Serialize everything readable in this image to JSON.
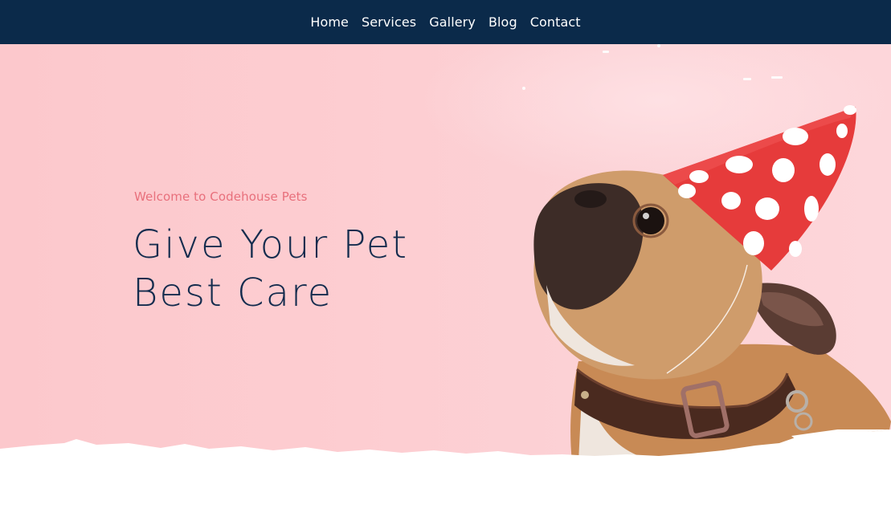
{
  "nav": {
    "items": [
      {
        "label": "Home"
      },
      {
        "label": "Services"
      },
      {
        "label": "Gallery"
      },
      {
        "label": "Blog"
      },
      {
        "label": "Contact"
      }
    ]
  },
  "hero": {
    "eyebrow": "Welcome to Codehouse Pets",
    "headline_line1": "Give Your Pet",
    "headline_line2": "Best Care",
    "image": "pug-in-party-hat"
  },
  "colors": {
    "nav_background": "#0b2a4a",
    "hero_background": "#fcc8cc",
    "eyebrow": "#e8707c",
    "headline": "#142c4e"
  }
}
